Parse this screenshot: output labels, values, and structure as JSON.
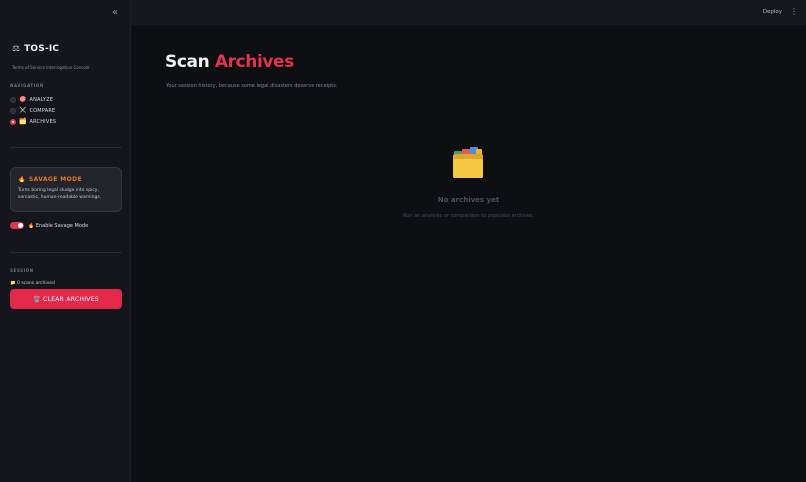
{
  "sidebar": {
    "brand_title": "TOS-IC",
    "brand_subtitle": "Terms of Service Interrogation Console",
    "nav_label": "NAVIGATION",
    "nav_items": [
      {
        "label": "ANALYZE",
        "emoji": "🎯",
        "selected": false
      },
      {
        "label": "COMPARE",
        "emoji": "⚔️",
        "selected": false
      },
      {
        "label": "ARCHIVES",
        "emoji": "🗂️",
        "selected": true
      }
    ],
    "savage_card": {
      "title": "SAVAGE MODE",
      "emoji": "🔥",
      "description": "Turns boring legal sludge into spicy, sarcastic, human-readable warnings."
    },
    "toggle": {
      "label": "🔥 Enable Savage Mode",
      "on": true
    },
    "session_label": "SESSION",
    "scan_count": "📁 0 scans archived",
    "clear_button": "🗑️ CLEAR ARCHIVES"
  },
  "header": {
    "deploy_label": "Deploy",
    "menu_icon": "⋮",
    "collapse_icon": "«"
  },
  "main": {
    "title_part1": "Scan",
    "title_part2": "Archives",
    "subtitle": "Your session history, because some legal disasters deserve receipts.",
    "empty_state": {
      "icon": "🗂️",
      "title": "No archives yet",
      "subtitle": "Run an analysis or comparison to populate archives."
    }
  },
  "colors": {
    "accent": "#e3344f",
    "savage_orange": "#e8732a",
    "sidebar_bg": "#15161b",
    "main_bg": "#0e0f12"
  }
}
